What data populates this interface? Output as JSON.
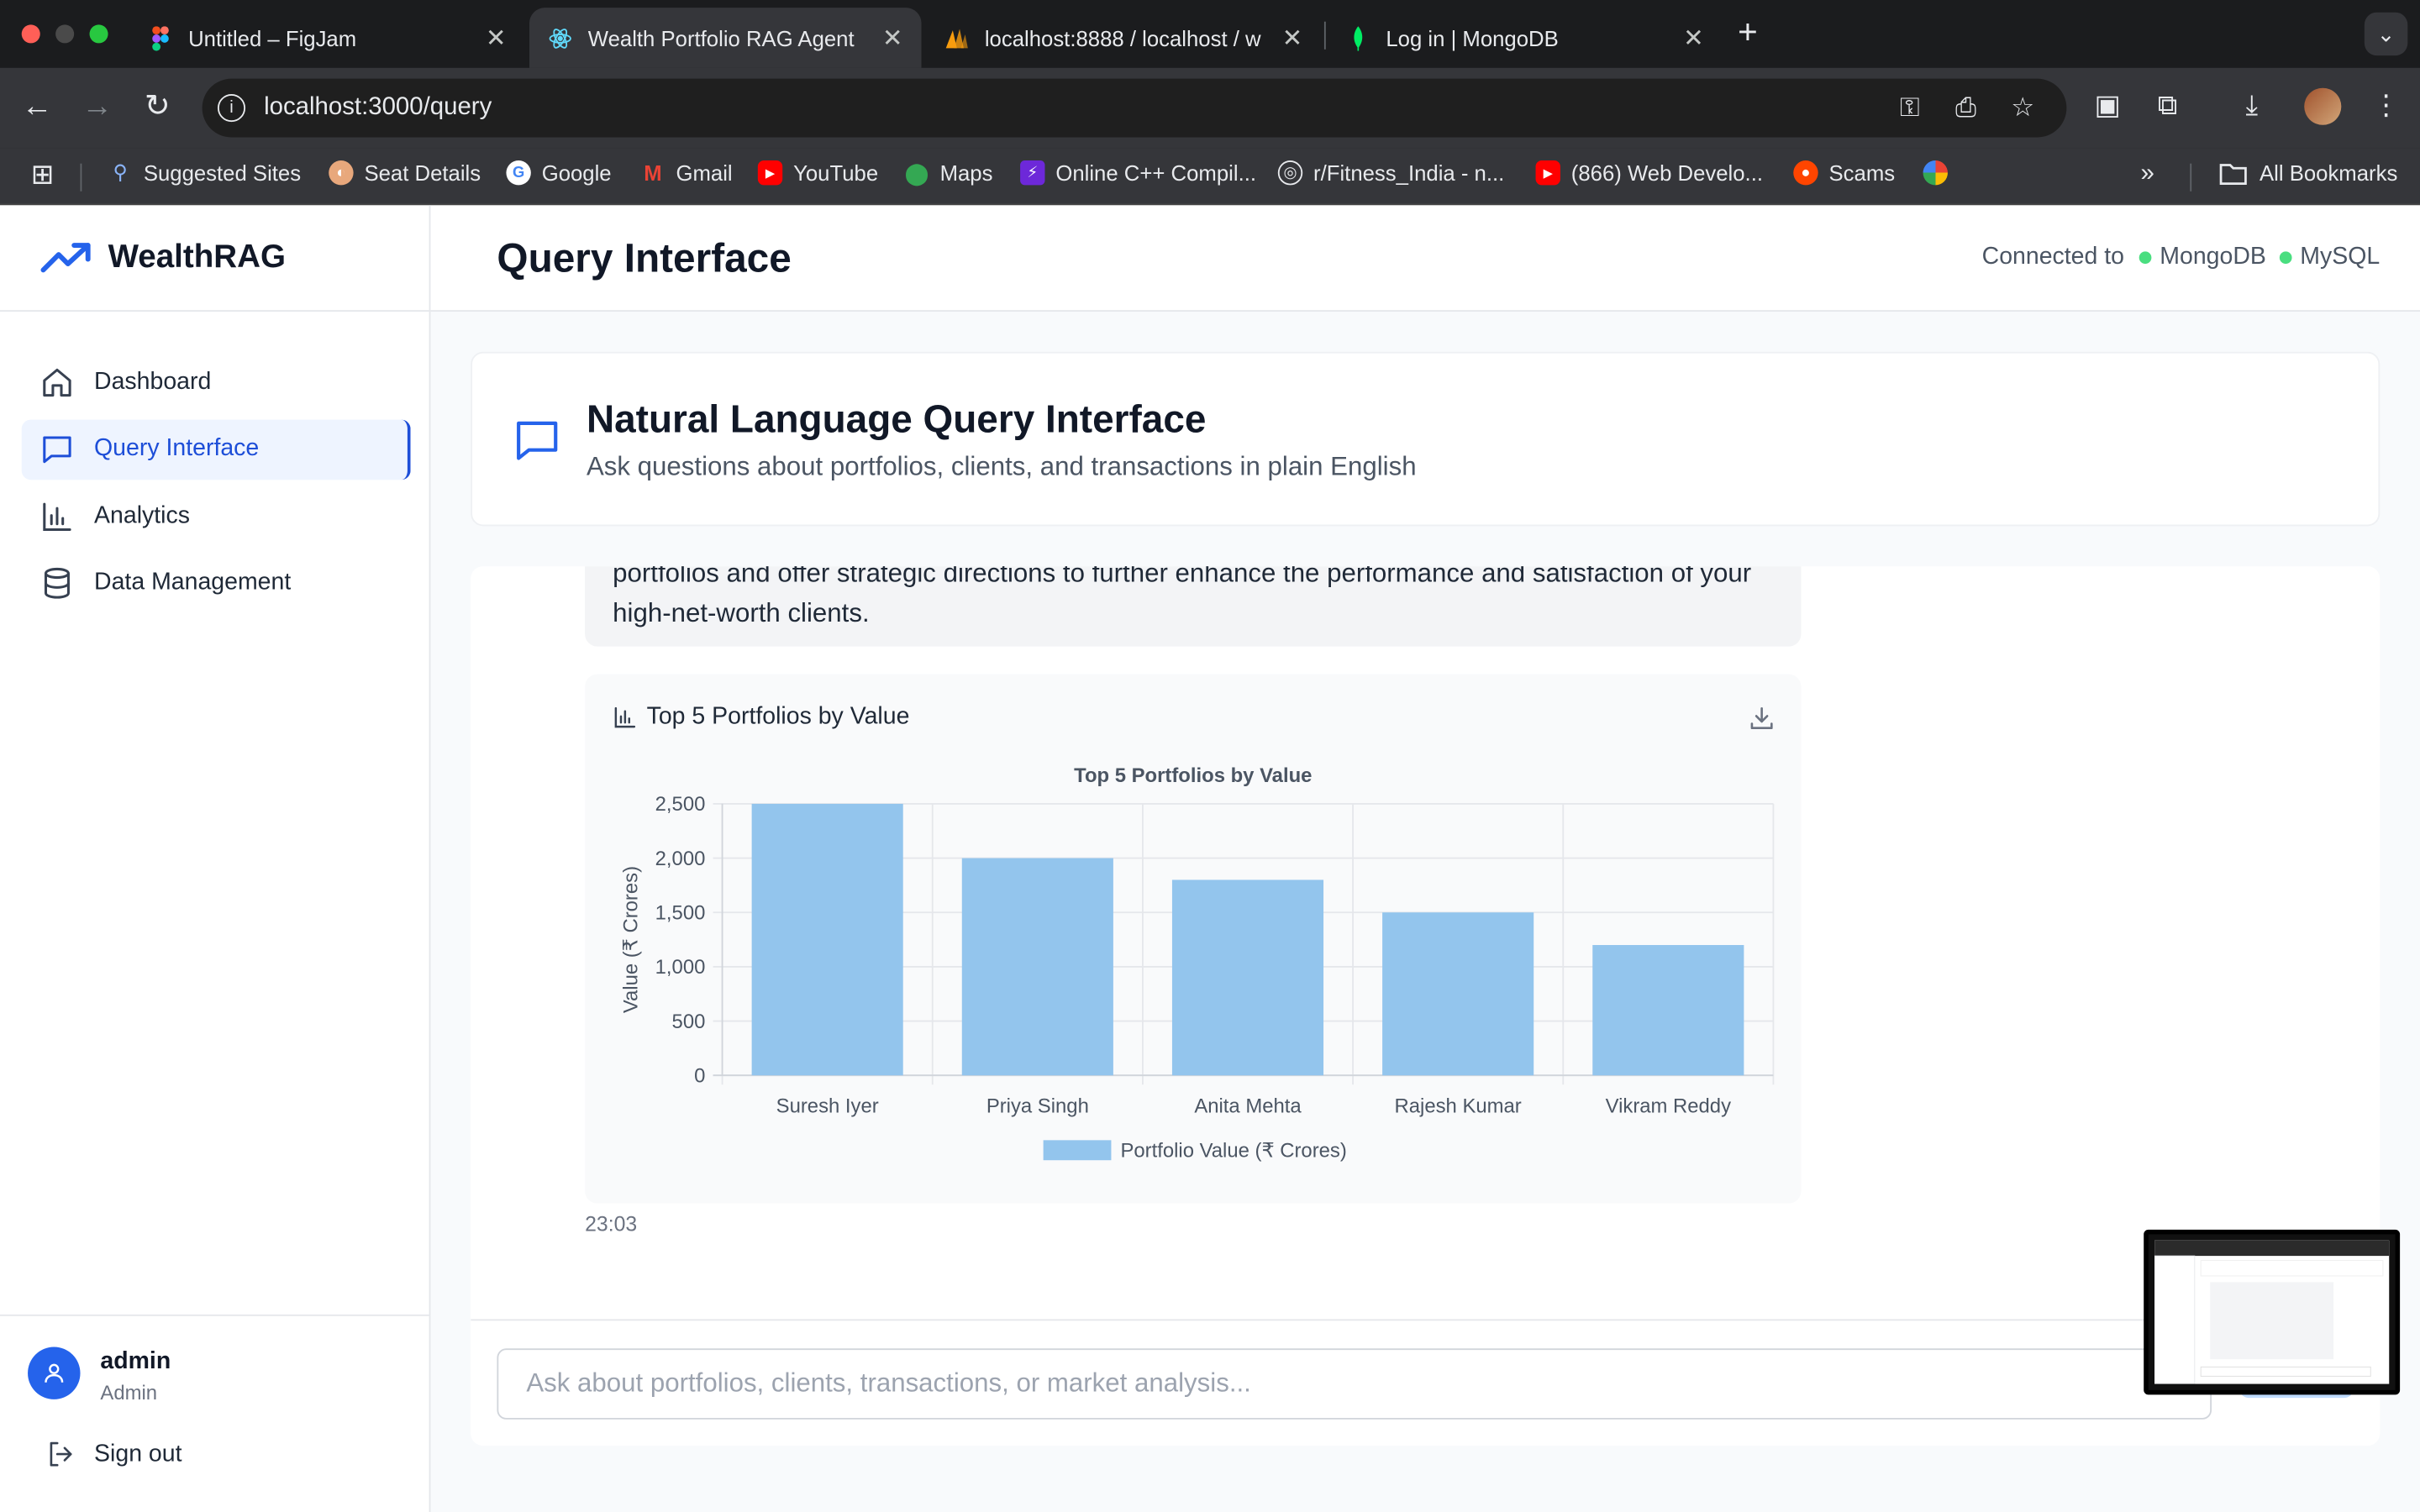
{
  "browser": {
    "tabs": [
      {
        "title": "Untitled – FigJam",
        "active": false
      },
      {
        "title": "Wealth Portfolio RAG Agent",
        "active": true
      },
      {
        "title": "localhost:8888 / localhost / w",
        "active": false
      },
      {
        "title": "Log in | MongoDB",
        "active": false
      }
    ],
    "url": "localhost:3000/query",
    "bookmarks": [
      {
        "label": "Suggested Sites"
      },
      {
        "label": "Seat Details"
      },
      {
        "label": "Google"
      },
      {
        "label": "Gmail"
      },
      {
        "label": "YouTube"
      },
      {
        "label": "Maps"
      },
      {
        "label": "Online C++ Compil..."
      },
      {
        "label": "r/Fitness_India - n..."
      },
      {
        "label": "(866) Web Develo..."
      },
      {
        "label": "Scams"
      }
    ],
    "all_bookmarks": "All Bookmarks",
    "more_glyph": "»"
  },
  "app": {
    "brand": "WealthRAG",
    "nav": [
      {
        "label": "Dashboard",
        "active": false
      },
      {
        "label": "Query Interface",
        "active": true
      },
      {
        "label": "Analytics",
        "active": false
      },
      {
        "label": "Data Management",
        "active": false
      }
    ],
    "user": {
      "name": "admin",
      "role": "Admin"
    },
    "signout": "Sign out",
    "page_title": "Query Interface",
    "connection": {
      "prefix": "Connected to",
      "dbs": [
        "MongoDB",
        "MySQL"
      ],
      "status_color": "#4ade80"
    },
    "query_card": {
      "title": "Natural Language Query Interface",
      "subtitle": "Ask questions about portfolios, clients, and transactions in plain English"
    },
    "message": {
      "text": "portfolios and offer strategic directions to further enhance the performance and satisfaction of your high-net-worth clients.",
      "time": "23:03"
    },
    "chart_card": {
      "header": "Top 5 Portfolios by Value"
    },
    "input": {
      "placeholder": "Ask about portfolios, clients, transactions, or market analysis...",
      "value": ""
    }
  },
  "chart_data": {
    "type": "bar",
    "title": "Top 5 Portfolios by Value",
    "categories": [
      "Suresh Iyer",
      "Priya Singh",
      "Anita Mehta",
      "Rajesh Kumar",
      "Vikram Reddy"
    ],
    "series": [
      {
        "name": "Portfolio Value (₹ Crores)",
        "values": [
          2500,
          2000,
          1800,
          1500,
          1200
        ],
        "color": "#93c5ed"
      }
    ],
    "xlabel": "",
    "ylabel": "Value (₹ Crores)",
    "ylim": [
      0,
      2500
    ],
    "yticks": [
      "0",
      "500",
      "1,000",
      "1,500",
      "2,000",
      "2,500"
    ],
    "grid": true,
    "legend": "bottom"
  }
}
